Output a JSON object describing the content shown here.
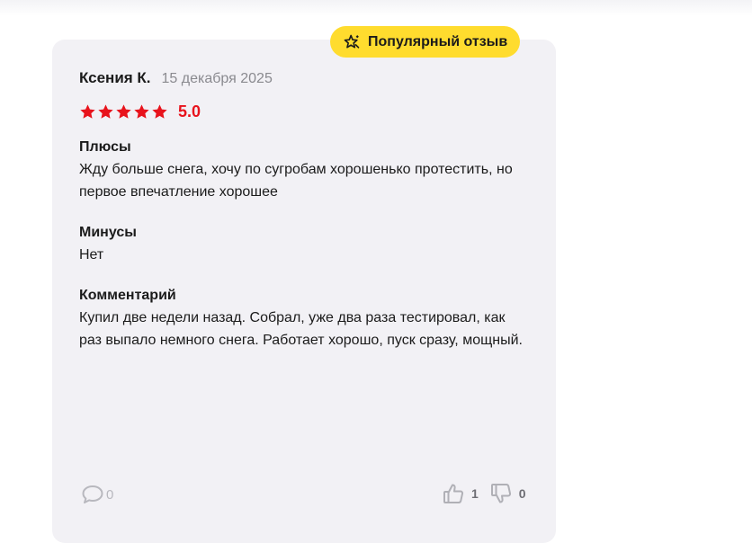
{
  "badge": {
    "icon": "sparkle-star-icon",
    "label": "Популярный отзыв",
    "color": "#ffdc2e"
  },
  "review": {
    "author": "Ксения К.",
    "date": "15 декабря 2025",
    "rating": {
      "stars": 5,
      "max": 5,
      "value_label": "5.0",
      "color": "#e8131c"
    },
    "pros": {
      "title": "Плюсы",
      "text": "Жду больше снега, хочу по сугробам хорошенько протестить, но первое впечатление хорошее"
    },
    "cons": {
      "title": "Минусы",
      "text": "Нет"
    },
    "comment": {
      "title": "Комментарий",
      "text": "Купил две недели назад. Собрал, уже два раза тестировал, как раз выпало немного снега. Работает хорошо, пуск сразу, мощный."
    }
  },
  "footer": {
    "comments": {
      "icon": "comment-bubble-icon",
      "count": "0"
    },
    "likes": {
      "icon": "thumbs-up-icon",
      "count": "1"
    },
    "dislikes": {
      "icon": "thumbs-down-icon",
      "count": "0"
    }
  },
  "colors": {
    "card_background": "#f2f1f5",
    "text": "#1b1b1b",
    "muted": "#8a8a8f"
  }
}
